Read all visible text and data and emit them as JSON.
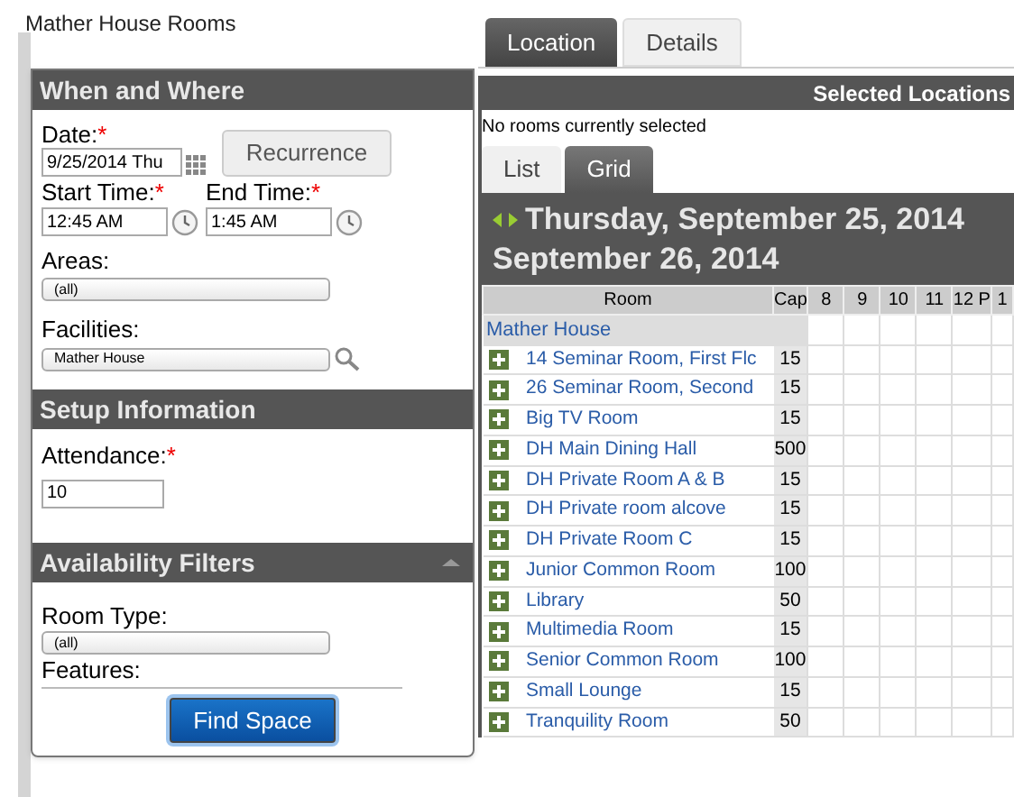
{
  "page_title": "Mather House Rooms",
  "form": {
    "sections": [
      {
        "title": "When and Where",
        "collapsible": false
      },
      {
        "title": "Setup Information",
        "collapsible": false
      },
      {
        "title": "Availability Filters",
        "collapsible": true
      }
    ],
    "date": {
      "label": "Date:",
      "required_mark": "*",
      "value": "9/25/2014 Thu"
    },
    "recurrence_button": "Recurrence",
    "start_time": {
      "label": "Start Time:",
      "required_mark": "*",
      "value": "12:45 AM"
    },
    "end_time": {
      "label": "End Time:",
      "required_mark": "*",
      "value": "1:45 AM"
    },
    "areas": {
      "label": "Areas:",
      "value": "(all)"
    },
    "facilities": {
      "label": "Facilities:",
      "value": "Mather House"
    },
    "attendance": {
      "label": "Attendance:",
      "required_mark": "*",
      "value": "10"
    },
    "room_type": {
      "label": "Room Type:",
      "value": "(all)"
    },
    "features": {
      "label": "Features:"
    },
    "find_button": "Find Space"
  },
  "tabs": [
    {
      "label": "Location",
      "selected": true
    },
    {
      "label": "Details",
      "selected": false
    }
  ],
  "selected_locations": {
    "title": "Selected Locations",
    "message": "No rooms currently selected"
  },
  "view_tabs": [
    {
      "label": "List",
      "selected": false
    },
    {
      "label": "Grid",
      "selected": true
    }
  ],
  "grid": {
    "date_line_1": "Thursday, September 25, 2014",
    "date_line_2": "September 26, 2014",
    "columns": [
      "Room",
      "Cap",
      "8",
      "9",
      "10",
      "11",
      "12 P",
      "1"
    ],
    "group": "Mather House",
    "rows": [
      {
        "room": "14 Seminar Room, First Flc",
        "cap": "15"
      },
      {
        "room": "26 Seminar Room, Second",
        "cap": "15"
      },
      {
        "room": "Big TV Room",
        "cap": "15"
      },
      {
        "room": "DH Main Dining Hall",
        "cap": "500"
      },
      {
        "room": "DH Private Room A & B",
        "cap": "15"
      },
      {
        "room": "DH Private room alcove",
        "cap": "15"
      },
      {
        "room": "DH Private Room C",
        "cap": "15"
      },
      {
        "room": "Junior Common Room",
        "cap": "100"
      },
      {
        "room": "Library",
        "cap": "50"
      },
      {
        "room": "Multimedia Room",
        "cap": "15"
      },
      {
        "room": "Senior Common Room",
        "cap": "100"
      },
      {
        "room": "Small Lounge",
        "cap": "15"
      },
      {
        "room": "Tranquility Room",
        "cap": "50"
      }
    ]
  }
}
